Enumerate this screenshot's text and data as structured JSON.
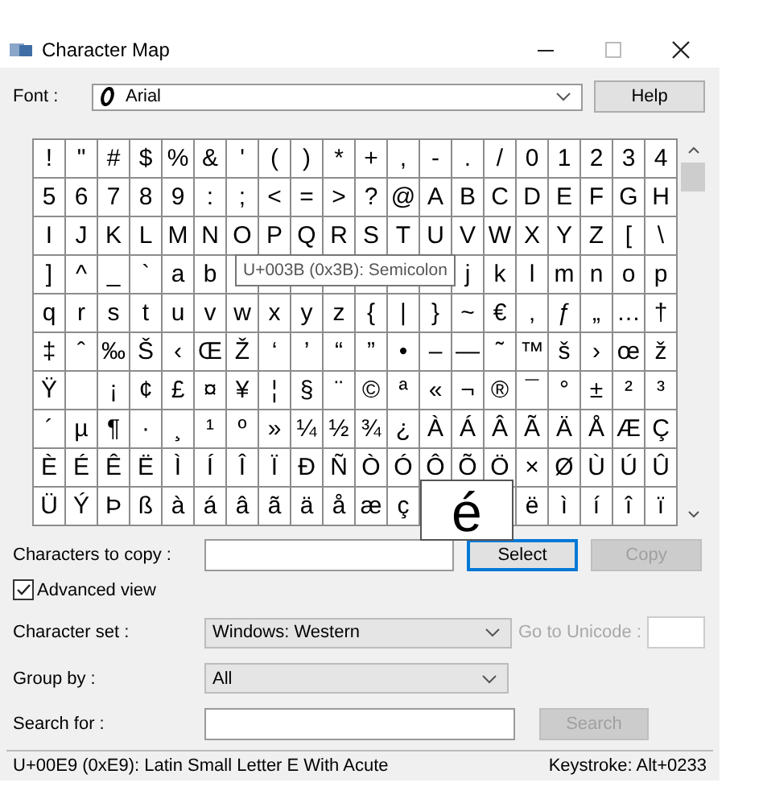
{
  "window": {
    "title": "Character Map"
  },
  "font": {
    "label": "Font :",
    "value": "Arial"
  },
  "help_button": {
    "label": "Help"
  },
  "grid": [
    [
      "!",
      "\"",
      "#",
      "$",
      "%",
      "&",
      "'",
      "(",
      ")",
      "*",
      "+",
      ",",
      "-",
      ".",
      "/",
      "0",
      "1",
      "2",
      "3",
      "4"
    ],
    [
      "5",
      "6",
      "7",
      "8",
      "9",
      ":",
      ";",
      "<",
      "=",
      ">",
      "?",
      "@",
      "A",
      "B",
      "C",
      "D",
      "E",
      "F",
      "G",
      "H"
    ],
    [
      "I",
      "J",
      "K",
      "L",
      "M",
      "N",
      "O",
      "P",
      "Q",
      "R",
      "S",
      "T",
      "U",
      "V",
      "W",
      "X",
      "Y",
      "Z",
      "[",
      "\\"
    ],
    [
      "]",
      "^",
      "_",
      "`",
      "a",
      "b",
      {
        "kind": "blank"
      },
      {
        "kind": "blank"
      },
      {
        "kind": "blank"
      },
      {
        "kind": "blank"
      },
      {
        "kind": "blank"
      },
      {
        "kind": "blank"
      },
      {
        "kind": "blank"
      },
      "j",
      "k",
      "l",
      "m",
      "n",
      "o",
      "p"
    ],
    [
      "q",
      "r",
      "s",
      "t",
      "u",
      "v",
      "w",
      "x",
      "y",
      "z",
      "{",
      "|",
      "}",
      "~",
      "€",
      "‚",
      "ƒ",
      "„",
      "…",
      "†"
    ],
    [
      "‡",
      "ˆ",
      "‰",
      "Š",
      "‹",
      "Œ",
      "Ž",
      "‘",
      "’",
      "“",
      "”",
      "•",
      "–",
      "—",
      "˜",
      "™",
      "š",
      "›",
      "œ",
      "ž"
    ],
    [
      "Ÿ",
      {
        "kind": "blank"
      },
      "¡",
      "¢",
      "£",
      "¤",
      "¥",
      "¦",
      "§",
      "¨",
      "©",
      "ª",
      "«",
      "¬",
      "®",
      "¯",
      "°",
      "±",
      "²",
      "³"
    ],
    [
      "´",
      "µ",
      "¶",
      "·",
      "¸",
      "¹",
      "º",
      "»",
      "¼",
      "½",
      "¾",
      "¿",
      "À",
      "Á",
      "Â",
      "Ã",
      "Ä",
      "Å",
      "Æ",
      "Ç"
    ],
    [
      "È",
      "É",
      "Ê",
      "Ë",
      "Ì",
      "Í",
      "Î",
      "Ï",
      "Ð",
      "Ñ",
      "Ò",
      "Ó",
      "Ô",
      "Õ",
      "Ö",
      "×",
      "Ø",
      "Ù",
      "Ú",
      "Û"
    ],
    [
      "Ü",
      "Ý",
      "Þ",
      "ß",
      "à",
      "á",
      "â",
      "ã",
      "ä",
      "å",
      "æ",
      "ç",
      {
        "kind": "blank"
      },
      {
        "kind": "blank"
      },
      {
        "kind": "blank"
      },
      "ë",
      "ì",
      "í",
      "î",
      "ï"
    ]
  ],
  "tooltip": "U+003B (0x3B): Semicolon",
  "magnifier": "é",
  "copy_row": {
    "label": "Characters to copy :",
    "buttons": [
      {
        "label": "Select",
        "focused": true,
        "disabled": false
      },
      {
        "label": "Copy",
        "focused": false,
        "disabled": true
      }
    ]
  },
  "advanced_view": {
    "label": "Advanced view",
    "checked": true
  },
  "character_set": {
    "label": "Character set :",
    "value": "Windows: Western"
  },
  "go_to_unicode": {
    "label": "Go to Unicode :",
    "disabled": true
  },
  "group_by": {
    "label": "Group by :",
    "value": "All"
  },
  "search": {
    "label": "Search for :",
    "button": {
      "label": "Search",
      "disabled": true
    }
  },
  "status_bar": {
    "description": "U+00E9 (0xE9): Latin Small Letter E With Acute",
    "keystroke": "Keystroke: Alt+0233"
  }
}
